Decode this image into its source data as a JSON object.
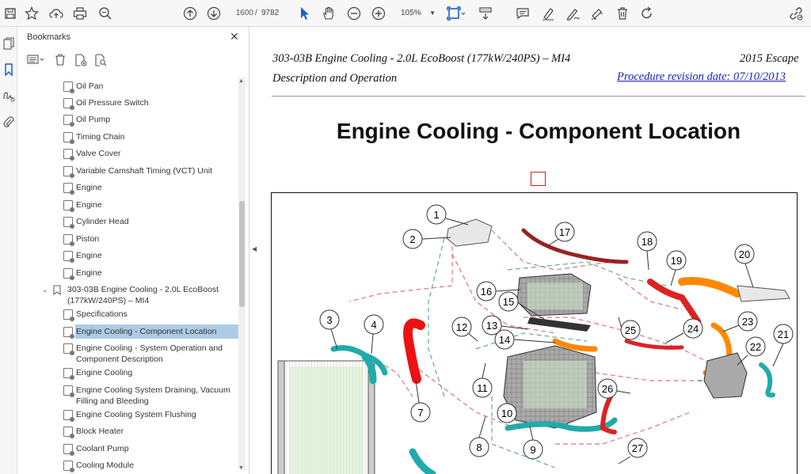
{
  "toolbar": {
    "page_current": "1600",
    "page_separator": "/",
    "page_total": "9782",
    "zoom": "105%"
  },
  "panel": {
    "title": "Bookmarks",
    "items": [
      {
        "label": "Oil Pan"
      },
      {
        "label": "Oil Pressure Switch"
      },
      {
        "label": "Oil Pump"
      },
      {
        "label": "Timing Chain"
      },
      {
        "label": "Valve Cover"
      },
      {
        "label": "Variable Camshaft Timing (VCT) Unit"
      },
      {
        "label": "Engine"
      },
      {
        "label": "Engine"
      },
      {
        "label": "Cylinder Head"
      },
      {
        "label": "Piston"
      },
      {
        "label": "Engine"
      },
      {
        "label": "Engine"
      },
      {
        "label": "303-03B Engine Cooling - 2.0L EcoBoost (177kW/240PS) – MI4"
      },
      {
        "label": "Specifications"
      },
      {
        "label": "Engine Cooling - Component Location"
      },
      {
        "label": "Engine Cooling - System Operation and Component Description"
      },
      {
        "label": "Engine Cooling"
      },
      {
        "label": "Engine Cooling System Draining, Vacuum Filling and Bleeding"
      },
      {
        "label": "Engine Cooling System Flushing"
      },
      {
        "label": "Block Heater"
      },
      {
        "label": "Coolant Pump"
      },
      {
        "label": "Cooling Module"
      }
    ]
  },
  "document": {
    "header_left_1": "303-03B Engine Cooling - 2.0L EcoBoost (177kW/240PS) – MI4",
    "header_right_1": "2015 Escape",
    "header_left_2": "Description and Operation",
    "header_right_2": "Procedure revision date: 07/10/2013",
    "title": "Engine Cooling - Component Location",
    "callouts": [
      "1",
      "2",
      "3",
      "4",
      "7",
      "8",
      "9",
      "10",
      "11",
      "12",
      "13",
      "14",
      "15",
      "16",
      "17",
      "18",
      "19",
      "20",
      "21",
      "22",
      "23",
      "24",
      "25",
      "26",
      "27"
    ]
  },
  "icons": [
    "save-icon",
    "star-icon",
    "upload-icon",
    "print-icon",
    "zoom-search-icon",
    "page-up-icon",
    "page-down-icon",
    "cursor-icon",
    "hand-icon",
    "zoom-out-icon",
    "zoom-in-icon",
    "fit-page-icon",
    "scroll-mode-icon",
    "comment-icon",
    "highlight-icon",
    "draw-icon",
    "fill-sign-icon",
    "delete-icon",
    "rotate-icon",
    "share-link-icon"
  ],
  "colors": {
    "accent": "#1a5fd0",
    "selection": "#aecbe6",
    "link": "#1a1ad0"
  }
}
